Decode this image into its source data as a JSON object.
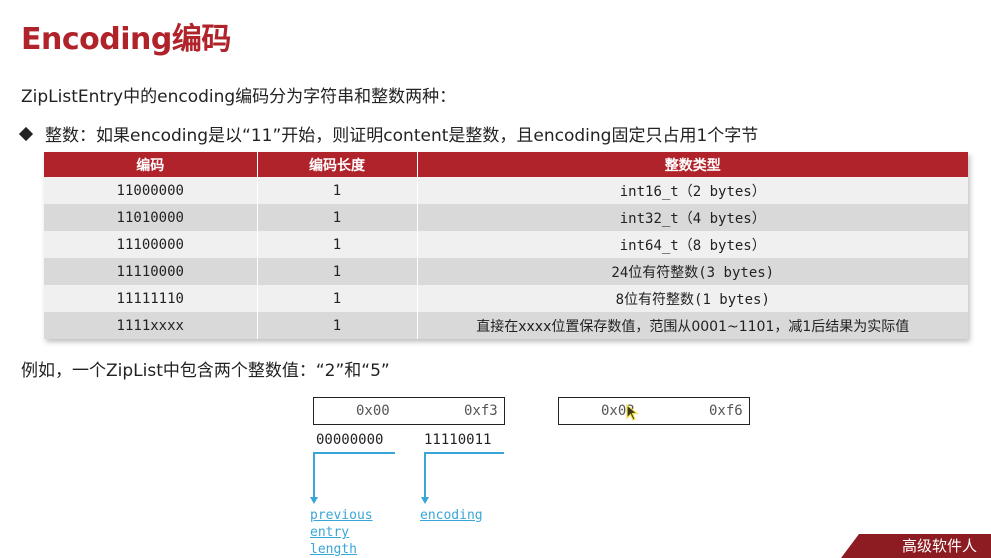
{
  "title": "Encoding编码",
  "intro": "ZipListEntry中的encoding编码分为字符串和整数两种：",
  "bullet": "整数：如果encoding是以“11”开始，则证明content是整数，且encoding固定只占用1个字节",
  "table": {
    "headers": [
      "编码",
      "编码长度",
      "整数类型"
    ],
    "rows": [
      [
        "11000000",
        "1",
        "int16_t（2 bytes）"
      ],
      [
        "11010000",
        "1",
        "int32_t（4 bytes）"
      ],
      [
        "11100000",
        "1",
        "int64_t（8 bytes）"
      ],
      [
        "11110000",
        "1",
        "24位有符整数(3 bytes)"
      ],
      [
        "11111110",
        "1",
        "8位有符整数(1 bytes)"
      ],
      [
        "1111xxxx",
        "1",
        "直接在xxxx位置保存数值，范围从0001~1101，减1后结果为实际值"
      ]
    ]
  },
  "example": "例如，一个ZipList中包含两个整数值：“2”和“5”",
  "diagram": {
    "entry1": {
      "prev": "0x00",
      "enc": "0xf3"
    },
    "entry2": {
      "prev": "0x02",
      "enc": "0xf6"
    },
    "bits_prev": "00000000",
    "bits_enc": "11110011",
    "label_prev": [
      "previous",
      "entry",
      "length"
    ],
    "label_enc": "encoding"
  },
  "watermark": "高级软件人"
}
